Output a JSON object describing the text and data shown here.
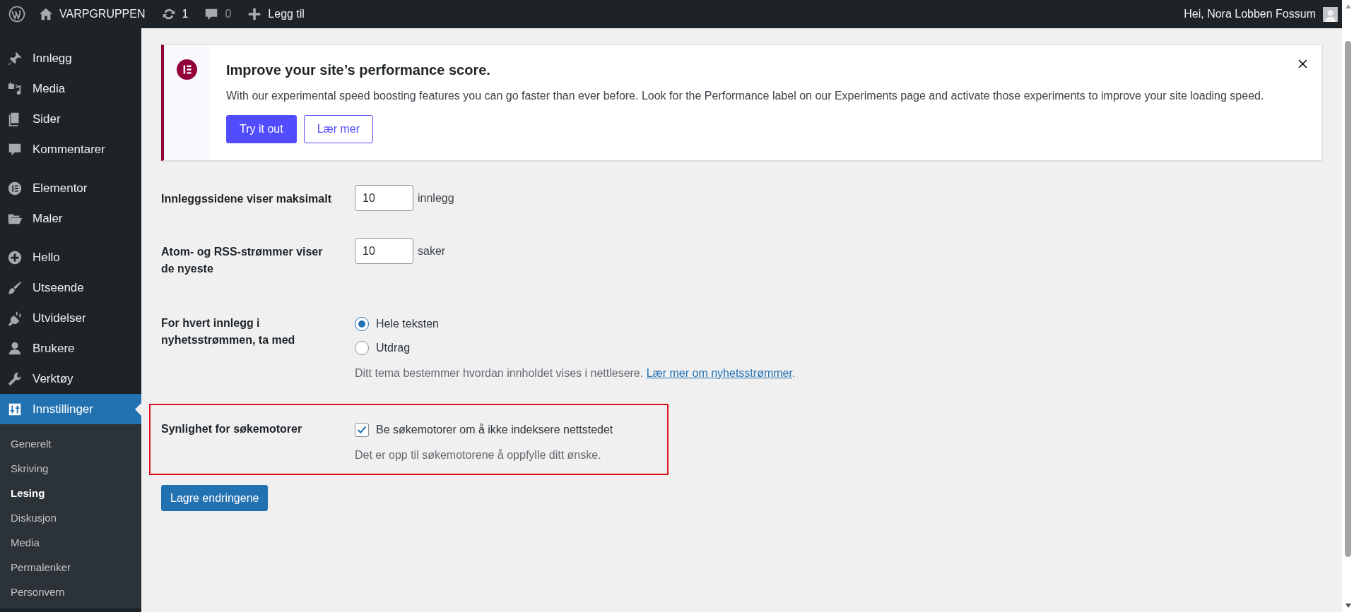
{
  "admin_bar": {
    "site_name": "VARPGRUPPEN",
    "updates": "1",
    "comments": "0",
    "new_label": "Legg til",
    "greeting": "Hei, Nora Lobben Fossum"
  },
  "sidebar": {
    "items": [
      {
        "label": "Innlegg",
        "selected": false
      },
      {
        "label": "Media",
        "selected": false
      },
      {
        "label": "Sider",
        "selected": false
      },
      {
        "label": "Kommentarer",
        "selected": false
      },
      {
        "label": "Elementor",
        "selected": false
      },
      {
        "label": "Maler",
        "selected": false
      },
      {
        "label": "Hello",
        "selected": false
      },
      {
        "label": "Utseende",
        "selected": false
      },
      {
        "label": "Utvidelser",
        "selected": false
      },
      {
        "label": "Brukere",
        "selected": false
      },
      {
        "label": "Verktøy",
        "selected": false
      },
      {
        "label": "Innstillinger",
        "selected": true
      }
    ],
    "submenu": [
      {
        "label": "Generelt",
        "selected": false
      },
      {
        "label": "Skriving",
        "selected": false
      },
      {
        "label": "Lesing",
        "selected": true
      },
      {
        "label": "Diskusjon",
        "selected": false
      },
      {
        "label": "Media",
        "selected": false
      },
      {
        "label": "Permalenker",
        "selected": false
      },
      {
        "label": "Personvern",
        "selected": false
      }
    ]
  },
  "notice": {
    "title": "Improve your site’s performance score.",
    "text": "With our experimental speed boosting features you can go faster than ever before. Look for the Performance label on our Experiments page and activate those experiments to improve your site loading speed.",
    "buttons": [
      {
        "label": "Try it out",
        "kind": "primary"
      },
      {
        "label": "Lær mer",
        "kind": "secondary"
      }
    ]
  },
  "settings": [
    {
      "kind": "number",
      "label": "Innleggssidene viser maksimalt",
      "value": "10",
      "unit": "innlegg",
      "highlighted": false
    },
    {
      "kind": "number",
      "label": "Atom- og RSS-strømmer viser de nyeste",
      "value": "10",
      "unit": "saker",
      "highlighted": false
    },
    {
      "kind": "radio",
      "label": "For hvert innlegg i nyhetsstrømmen, ta med",
      "options": [
        {
          "label": "Hele teksten",
          "selected": true
        },
        {
          "label": "Utdrag",
          "selected": false
        }
      ],
      "description": "Ditt tema bestemmer hvordan innholdet vises i nettlesere.",
      "link": "Lær mer om nyhetsstrømmer",
      "link_suffix": ".",
      "highlighted": false
    },
    {
      "kind": "checkbox",
      "label": "Synlighet for søkemotorer",
      "option": "Be søkemotorer om å ikke indeksere nettstedet",
      "checked": true,
      "description": "Det er opp til søkemotorene å oppfylle ditt ønske.",
      "highlighted": true
    }
  ],
  "save_button": "Lagre endringene"
}
